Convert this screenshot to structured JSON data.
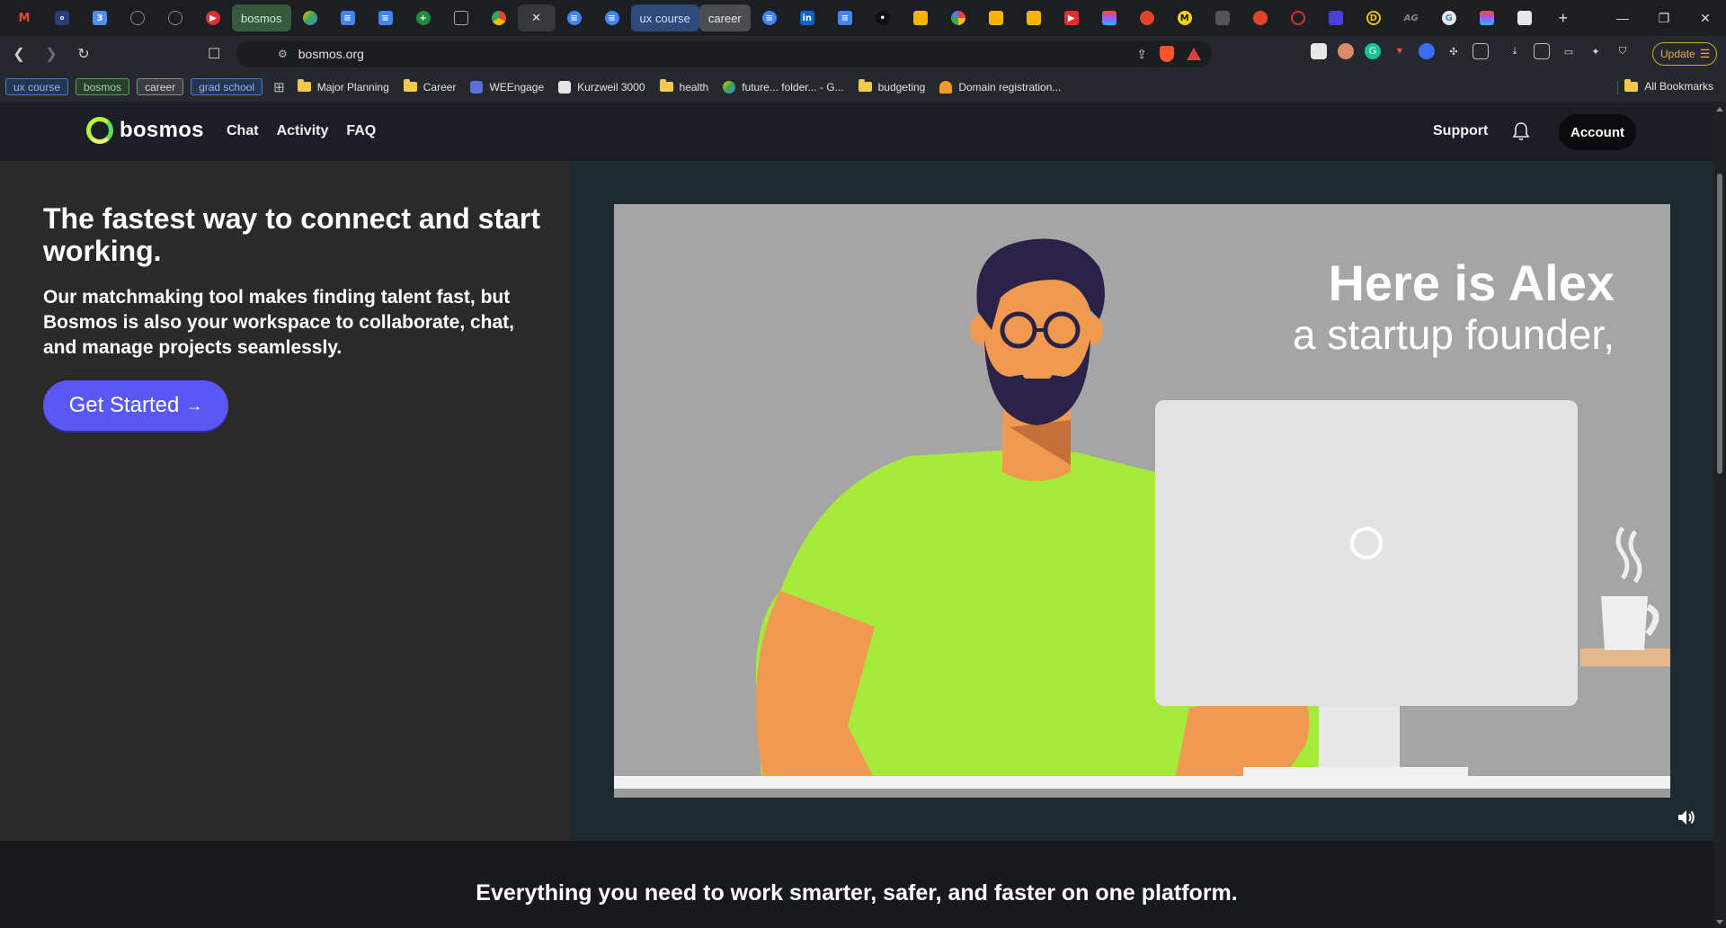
{
  "browser": {
    "tab_groups": {
      "bosmos": "bosmos",
      "ux_course": "ux course",
      "career": "career"
    },
    "active_tab_close": "✕",
    "new_tab": "+",
    "window": {
      "minimize": "—",
      "restore": "❐",
      "close": "✕"
    },
    "address": {
      "url": "bosmos.org",
      "update_label": "Update"
    },
    "bookmark_chips": [
      "ux course",
      "bosmos",
      "career",
      "grad school"
    ],
    "bookmarks": [
      {
        "label": "Major Planning",
        "icon": "folder-icon"
      },
      {
        "label": "Career",
        "icon": "folder-icon"
      },
      {
        "label": "WEEngage",
        "icon": "weengage-icon"
      },
      {
        "label": "Kurzweil 3000",
        "icon": "kurzweil-icon"
      },
      {
        "label": "health",
        "icon": "folder-icon"
      },
      {
        "label": "future... folder... - G...",
        "icon": "drive-icon"
      },
      {
        "label": "budgeting",
        "icon": "folder-icon"
      },
      {
        "label": "Domain registration...",
        "icon": "cloud-icon"
      }
    ],
    "all_bookmarks": "All Bookmarks"
  },
  "site": {
    "logo_text": "bosmos",
    "nav": {
      "chat": "Chat",
      "activity": "Activity",
      "faq": "FAQ"
    },
    "support": "Support",
    "account": "Account"
  },
  "hero": {
    "title": "The fastest way to connect and start working.",
    "subtitle": "Our matchmaking tool makes finding talent fast, but Bosmos is also your workspace to collaborate, chat, and manage projects seamlessly.",
    "cta_label": "Get Started",
    "cta_arrow": "→"
  },
  "video": {
    "headline": "Here is Alex",
    "subheadline": "a startup founder,"
  },
  "features": {
    "title": "Everything you need to work smarter, safer, and faster on one platform."
  },
  "colors": {
    "accent": "#5b57f5",
    "logo_green": "#b6f53b",
    "shirt": "#a6eb3c",
    "skin": "#ef9a50"
  }
}
